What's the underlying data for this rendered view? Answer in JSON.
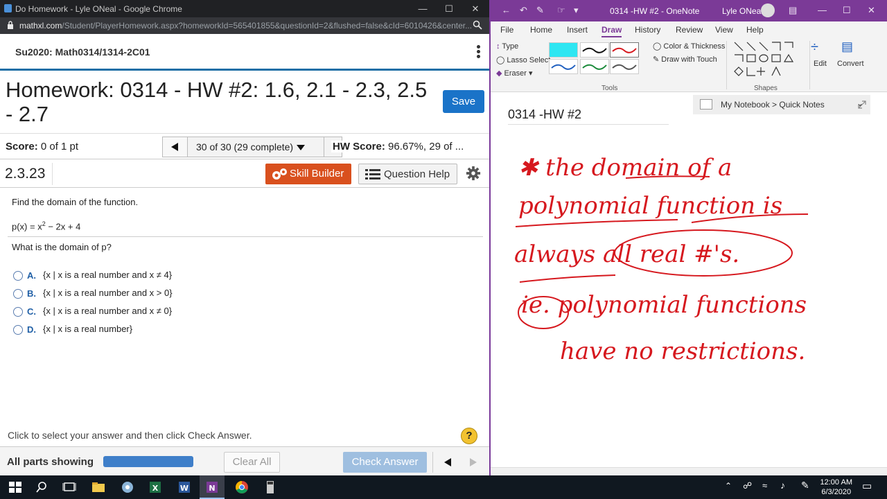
{
  "chrome": {
    "window_title": "Do Homework - Lyle ONeal - Google Chrome",
    "url_host": "mathxl.com",
    "url_path": "/Student/PlayerHomework.aspx?homeworkId=565401855&questionId=2&flushed=false&cId=6010426&center..."
  },
  "mathxl": {
    "course": "Su2020: Math0314/1314-2C01",
    "homework_title": "Homework: 0314 - HW #2: 1.6, 2.1 - 2.3, 2.5 - 2.7",
    "save_label": "Save",
    "score_label": "Score:",
    "score_value": "0 of 1 pt",
    "question_selector": "30 of 30 (29 complete)",
    "hw_score_label": "HW Score:",
    "hw_score_value": "96.67%, 29 of ...",
    "problem_number": "2.3.23",
    "skill_builder_label": "Skill Builder",
    "question_help_label": "Question Help",
    "prompt": "Find the domain of the function.",
    "function_prefix": "p(x) = x",
    "function_exponent": "2",
    "function_suffix": " − 2x + 4",
    "question": "What is the domain of p?",
    "options": [
      {
        "letter": "A.",
        "text": "{x | x is a real number and x ≠ 4}"
      },
      {
        "letter": "B.",
        "text": "{x | x is a real number and x > 0}"
      },
      {
        "letter": "C.",
        "text": "{x | x is a real number and x ≠ 0}"
      },
      {
        "letter": "D.",
        "text": "{x | x is a real number}"
      }
    ],
    "instruction": "Click to select your answer and then click Check Answer.",
    "help_mark": "?",
    "parts_label": "All parts showing",
    "progress_fraction": 1.0,
    "clear_all_label": "Clear All",
    "check_answer_label": "Check Answer",
    "accent_color": "#1a73c8",
    "skill_builder_color": "#d9501e"
  },
  "onenote": {
    "window_title": "0314 -HW #2  -  OneNote",
    "user": "Lyle ONeal",
    "menu": [
      "File",
      "Home",
      "Insert",
      "Draw",
      "History",
      "Review",
      "View",
      "Help"
    ],
    "active_tab": "Draw",
    "tools": {
      "type": "Type",
      "lasso": "Lasso Select",
      "eraser": "Eraser",
      "color_thickness": "Color & Thickness",
      "draw_with_touch": "Draw with Touch",
      "edit": "Edit",
      "convert": "Convert",
      "group_tools": "Tools",
      "group_shapes": "Shapes"
    },
    "notebook_path": "My Notebook > Quick Notes",
    "page_title": "0314 -HW #2",
    "ink_lines": [
      "✱ the domain of a",
      "polynomial function is",
      "always all real #'s.",
      "ie. polynomial functions",
      "have no restrictions."
    ],
    "ink_color": "#d6181e",
    "brand_color": "#7b3a97"
  },
  "taskbar": {
    "time": "12:00 AM",
    "date": "6/3/2020"
  }
}
